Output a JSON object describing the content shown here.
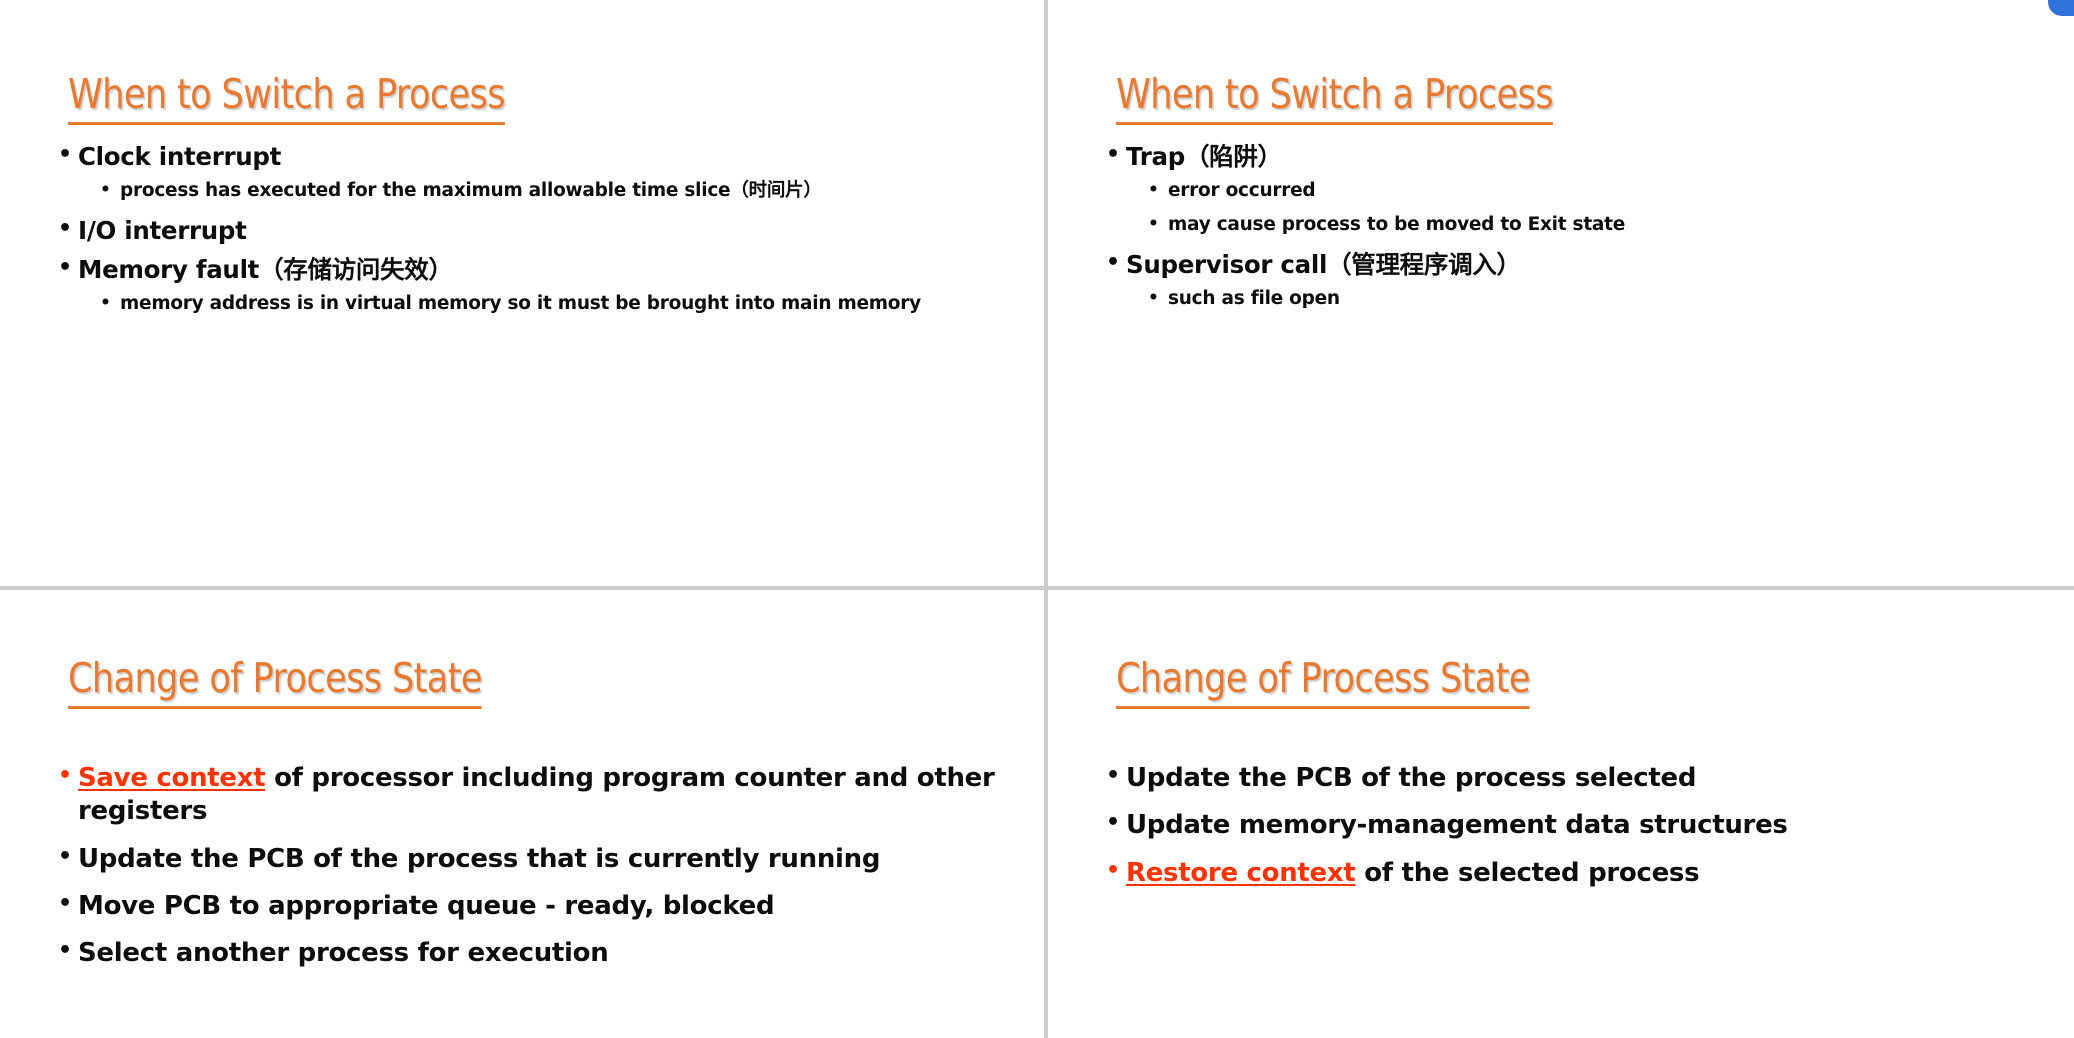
{
  "document": {
    "type": "presentation-handout",
    "slide_count": 4,
    "accent_color": "#E8792F",
    "emphasis_color": "#FF3300",
    "body_color": "#0D0D0D",
    "divider_color": "#CCCCCC",
    "background_color": "#FFFFFF"
  },
  "slides": [
    {
      "position": "top-left",
      "title": "When to Switch a Process",
      "bullets": [
        {
          "level": 1,
          "text": "Clock interrupt",
          "emphasis": null,
          "children": [
            {
              "level": 2,
              "text": "process has executed for the maximum allowable time slice（时间片）"
            }
          ]
        },
        {
          "level": 1,
          "text": "I/O interrupt",
          "emphasis": null,
          "children": []
        },
        {
          "level": 1,
          "text": "Memory fault（存储访问失效）",
          "emphasis": null,
          "children": [
            {
              "level": 2,
              "text": "memory address is in virtual memory so it must be brought into main memory"
            }
          ]
        }
      ]
    },
    {
      "position": "top-right",
      "title": "When to Switch a Process",
      "bullets": [
        {
          "level": 1,
          "text": "Trap（陷阱）",
          "emphasis": null,
          "children": [
            {
              "level": 2,
              "text": "error occurred"
            },
            {
              "level": 2,
              "text": "may cause process to be moved to Exit state"
            }
          ]
        },
        {
          "level": 1,
          "text": "Supervisor call（管理程序调入）",
          "emphasis": null,
          "children": [
            {
              "level": 2,
              "text": "such as file open"
            }
          ]
        }
      ]
    },
    {
      "position": "bottom-left",
      "title": "Change of Process State",
      "bullets": [
        {
          "level": 1,
          "emphasis": "Save context",
          "text_after_emphasis": " of processor including program counter and other registers",
          "text": "Save context of processor including program counter and other registers",
          "children": []
        },
        {
          "level": 1,
          "text": "Update the PCB of the process that is currently running",
          "emphasis": null,
          "children": []
        },
        {
          "level": 1,
          "text": "Move PCB to appropriate queue - ready, blocked",
          "emphasis": null,
          "children": []
        },
        {
          "level": 1,
          "text": "Select another process for execution",
          "emphasis": null,
          "children": []
        }
      ]
    },
    {
      "position": "bottom-right",
      "title": "Change of Process State",
      "bullets": [
        {
          "level": 1,
          "text": "Update the PCB of the process selected",
          "emphasis": null,
          "children": []
        },
        {
          "level": 1,
          "text": "Update memory-management data structures",
          "emphasis": null,
          "children": []
        },
        {
          "level": 1,
          "emphasis": "Restore context",
          "text_after_emphasis": " of the selected process",
          "text": "Restore context of the selected process",
          "children": []
        }
      ]
    }
  ],
  "tl": {
    "title": "When to Switch a Process",
    "b1": "Clock interrupt",
    "b1s1": "process has executed for the maximum allowable time slice（时间片）",
    "b2": "I/O interrupt",
    "b3": "Memory fault（存储访问失效）",
    "b3s1": "memory address is in virtual memory so it must be brought into main memory"
  },
  "tr": {
    "title": "When to Switch a Process",
    "b1": "Trap（陷阱）",
    "b1s1": "error occurred",
    "b1s2": "may cause process to be moved to Exit state",
    "b2": "Supervisor call（管理程序调入）",
    "b2s1": "such as file open"
  },
  "bl": {
    "title": "Change of Process State",
    "b1_hl": "Save context",
    "b1_rest": " of processor including program counter and other registers",
    "b2": "Update the PCB of the process that is currently running",
    "b3": "Move PCB to appropriate queue - ready, blocked",
    "b4": "Select another process for execution"
  },
  "br": {
    "title": "Change of Process State",
    "b1": "Update the PCB of the process selected",
    "b2": "Update memory-management data structures",
    "b3_hl": "Restore context",
    "b3_rest": " of the selected process"
  }
}
